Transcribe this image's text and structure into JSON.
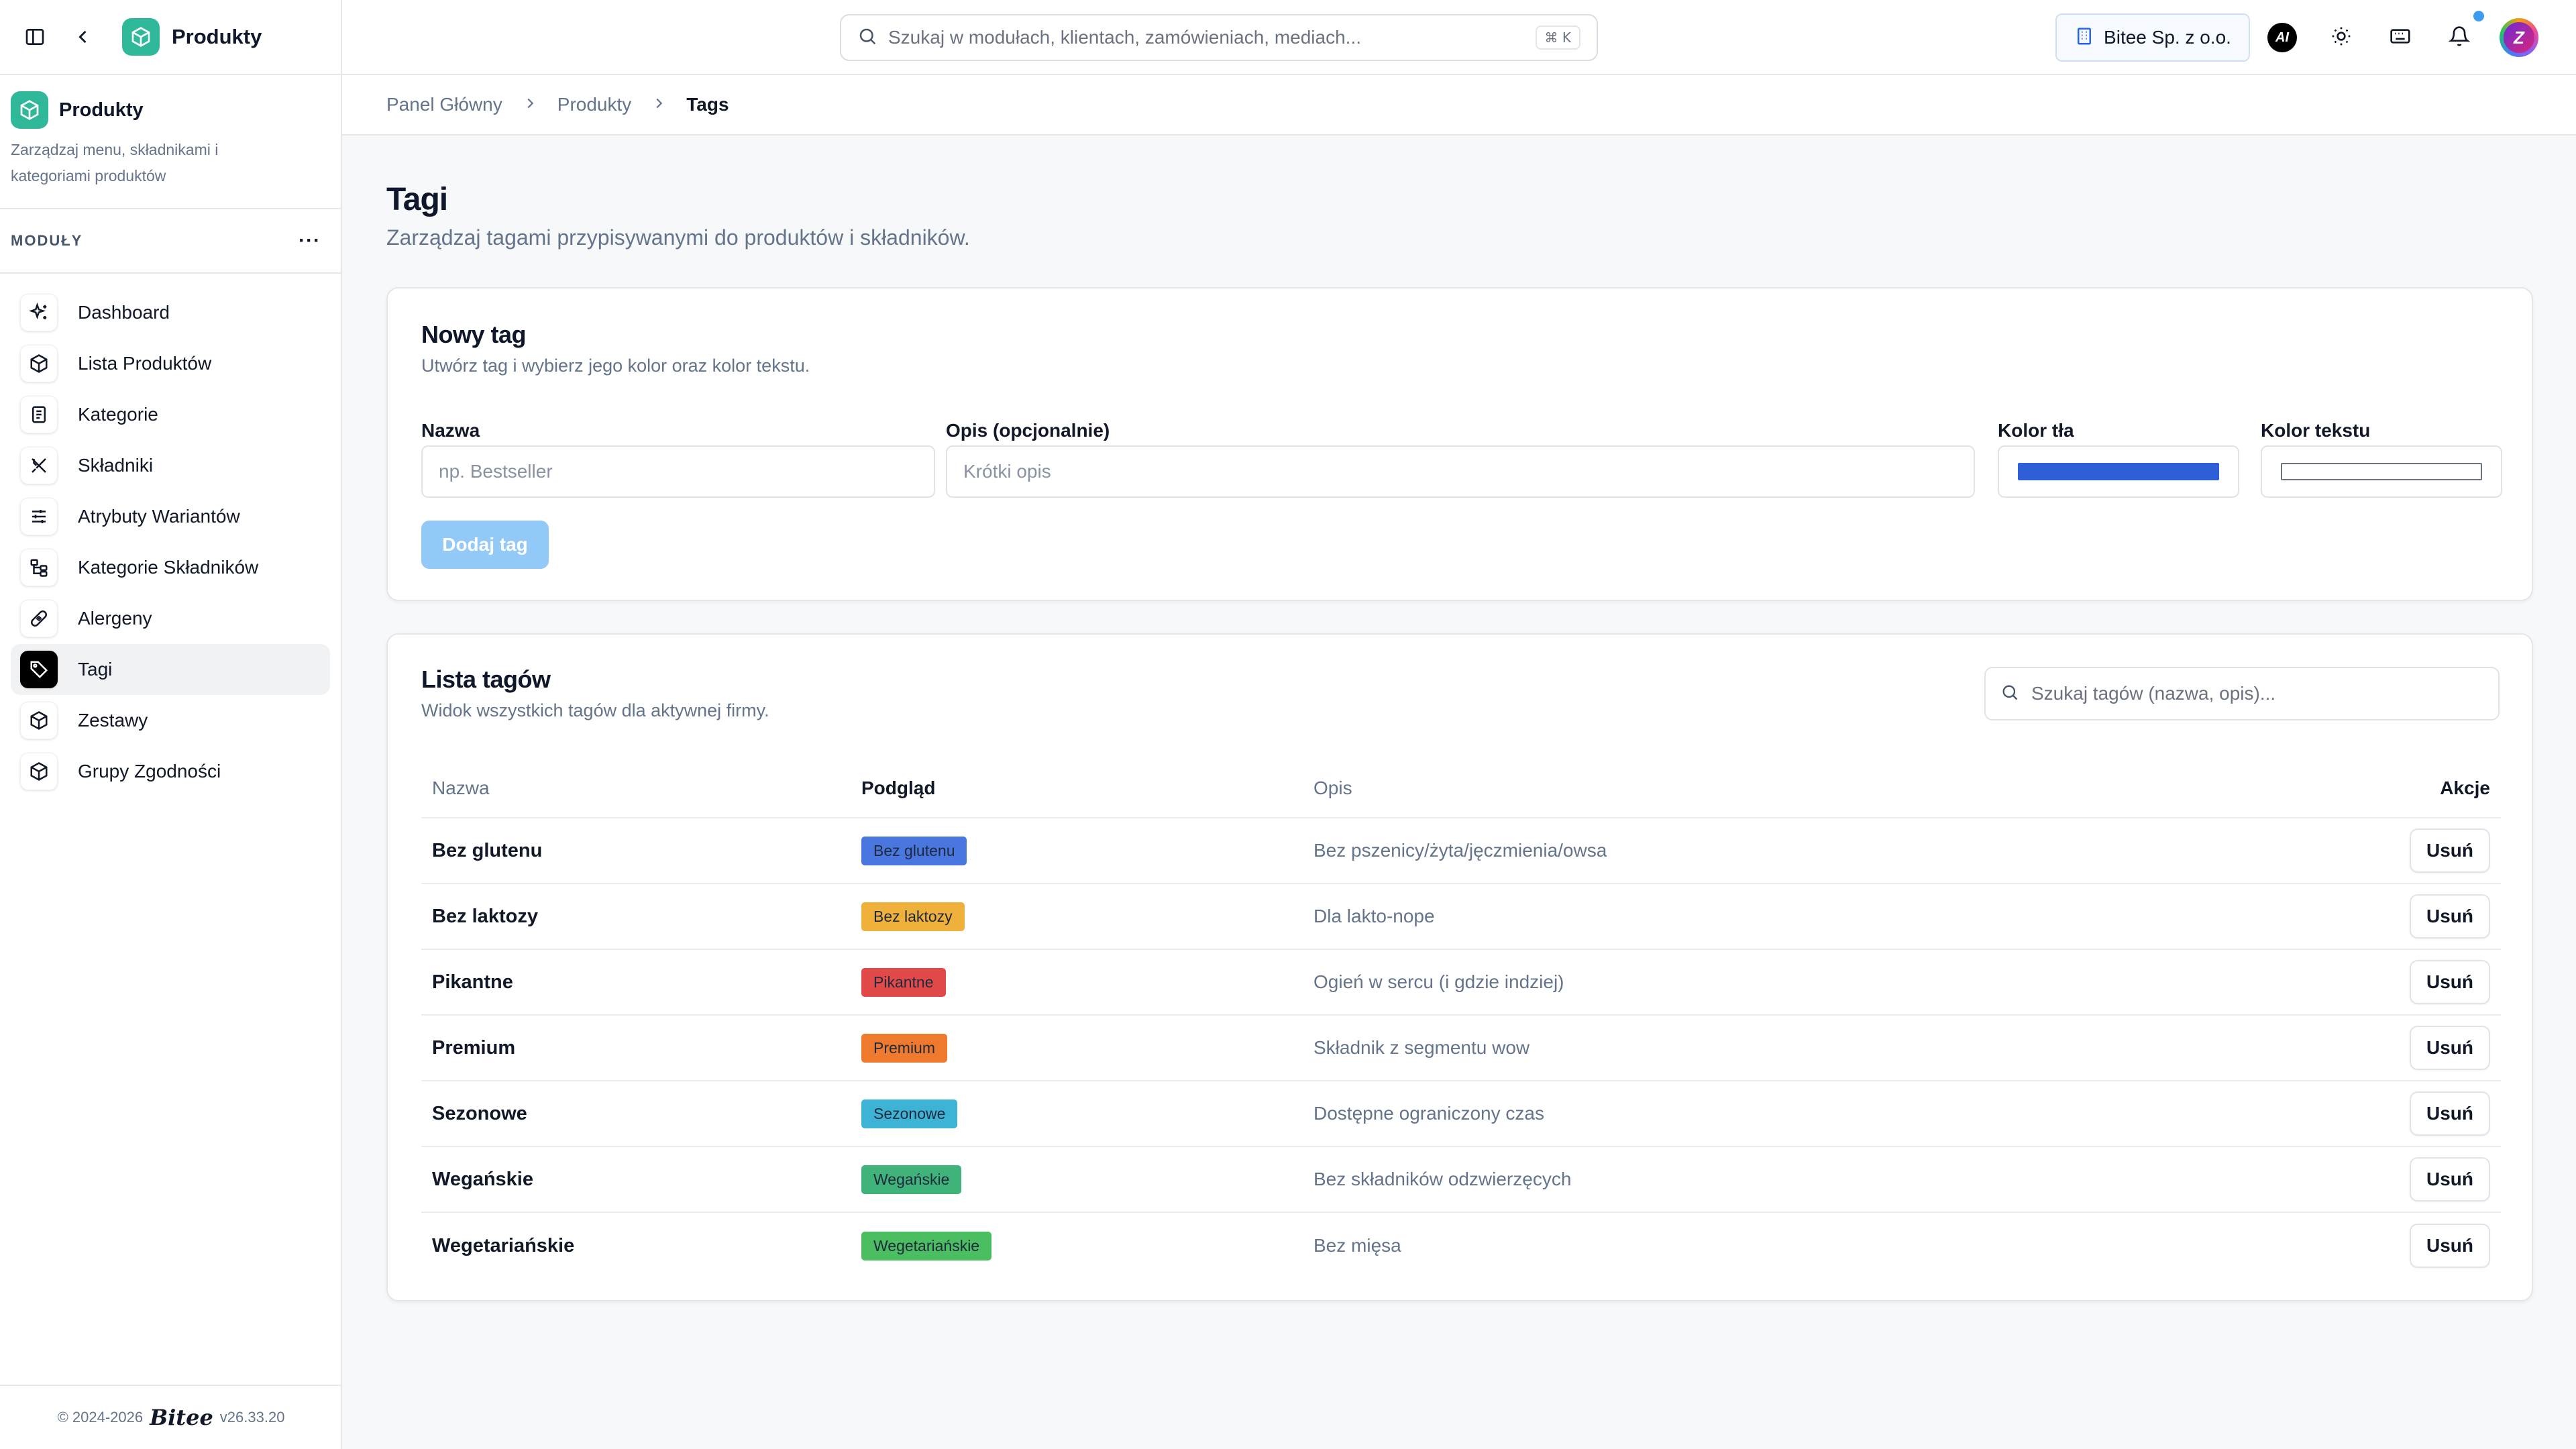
{
  "app": {
    "name": "Produkty"
  },
  "module": {
    "title": "Produkty",
    "description": "Zarządzaj menu, składnikami i kategoriami produktów"
  },
  "sidebar": {
    "section_label": "MODUŁY",
    "more_label": "···",
    "items": [
      {
        "label": "Dashboard",
        "icon": "sparkles-icon"
      },
      {
        "label": "Lista Produktów",
        "icon": "box-icon"
      },
      {
        "label": "Kategorie",
        "icon": "document-icon"
      },
      {
        "label": "Składniki",
        "icon": "utensils-crossed-icon"
      },
      {
        "label": "Atrybuty Wariantów",
        "icon": "sliders-icon"
      },
      {
        "label": "Kategorie Składników",
        "icon": "hierarchy-icon"
      },
      {
        "label": "Alergeny",
        "icon": "bandage-icon"
      },
      {
        "label": "Tagi",
        "icon": "tag-icon",
        "active": true
      },
      {
        "label": "Zestawy",
        "icon": "box-icon"
      },
      {
        "label": "Grupy Zgodności",
        "icon": "box-icon"
      }
    ],
    "footer": {
      "copyright": "© 2024-2026",
      "brand": "Bitee",
      "version": "v26.33.20"
    }
  },
  "topbar": {
    "search_placeholder": "Szukaj w modułach, klientach, zamówieniach, mediach...",
    "search_shortcut": "⌘ K",
    "company": "Bitee Sp. z o.o.",
    "ai_label": "AI",
    "avatar_letter": "Z"
  },
  "breadcrumb": {
    "items": [
      "Panel Główny",
      "Produkty"
    ],
    "current": "Tags"
  },
  "page": {
    "title": "Tagi",
    "subtitle": "Zarządzaj tagami przypisywanymi do produktów i składników."
  },
  "new_tag": {
    "title": "Nowy tag",
    "subtitle": "Utwórz tag i wybierz jego kolor oraz kolor tekstu.",
    "name_label": "Nazwa",
    "name_placeholder": "np. Bestseller",
    "desc_label": "Opis (opcjonalnie)",
    "desc_placeholder": "Krótki opis",
    "bg_color_label": "Kolor tła",
    "bg_color_value": "#2f5fd6",
    "text_color_label": "Kolor tekstu",
    "text_color_value": "#ffffff",
    "add_button": "Dodaj tag"
  },
  "tag_list": {
    "title": "Lista tagów",
    "subtitle": "Widok wszystkich tagów dla aktywnej firmy.",
    "search_placeholder": "Szukaj tagów (nazwa, opis)...",
    "columns": [
      "Nazwa",
      "Podgląd",
      "Opis",
      "Akcje"
    ],
    "delete_label": "Usuń",
    "rows": [
      {
        "name": "Bez glutenu",
        "preview": "Bez glutenu",
        "bg": "#4a76e0",
        "fg": "#1e293b",
        "description": "Bez pszenicy/żyta/jęczmienia/owsa"
      },
      {
        "name": "Bez laktozy",
        "preview": "Bez laktozy",
        "bg": "#f0b13c",
        "fg": "#1e293b",
        "description": "Dla lakto-nope"
      },
      {
        "name": "Pikantne",
        "preview": "Pikantne",
        "bg": "#e24a4a",
        "fg": "#1e293b",
        "description": "Ogień w sercu (i gdzie indziej)"
      },
      {
        "name": "Premium",
        "preview": "Premium",
        "bg": "#ef7a2e",
        "fg": "#1e293b",
        "description": "Składnik z segmentu wow"
      },
      {
        "name": "Sezonowe",
        "preview": "Sezonowe",
        "bg": "#3db3d6",
        "fg": "#1e293b",
        "description": "Dostępne ograniczony czas"
      },
      {
        "name": "Wegańskie",
        "preview": "Wegańskie",
        "bg": "#3fb37a",
        "fg": "#1e293b",
        "description": "Bez składników odzwierzęcych"
      },
      {
        "name": "Wegetariańskie",
        "preview": "Wegetariańskie",
        "bg": "#4cbe62",
        "fg": "#1e293b",
        "description": "Bez mięsa"
      }
    ]
  }
}
